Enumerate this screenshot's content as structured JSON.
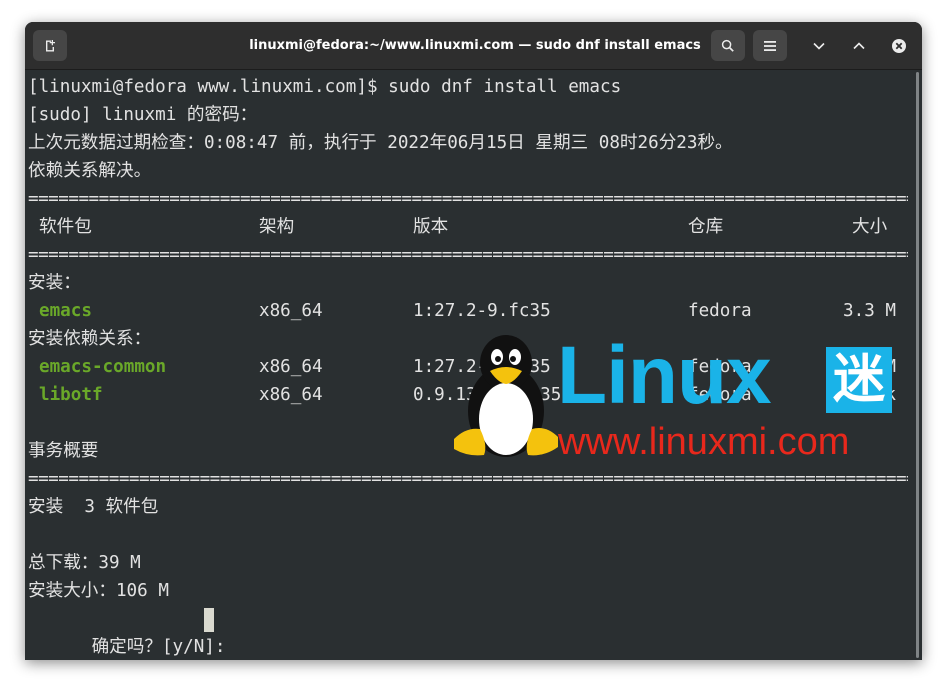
{
  "window": {
    "title": "linuxmi@fedora:~/www.linuxmi.com — sudo dnf install emacs",
    "icons": [
      "new-tab-icon",
      "search-icon",
      "hamburger-menu-icon",
      "minimize-icon",
      "maximize-icon",
      "close-icon"
    ]
  },
  "terminal": {
    "line1": "[linuxmi@fedora www.linuxmi.com]$ sudo dnf install emacs",
    "line2": "[sudo] linuxmi 的密码：",
    "line3": "上次元数据过期检查：0:08:47 前，执行于 2022年06月15日 星期三 08时26分23秒。",
    "line4": "依赖关系解决。",
    "rule": "================================================================================================================================================================",
    "headers": {
      "package": "软件包",
      "arch": "架构",
      "version": "版本",
      "repo": "仓库",
      "size": "大小"
    },
    "install_label": "安装：",
    "deps_label": "安装依赖关系：",
    "packages": [
      {
        "name": "emacs",
        "arch": "x86_64",
        "version": "1:27.2-9.fc35",
        "repo": "fedora",
        "size": "3.3 M"
      },
      {
        "name": "emacs-common",
        "arch": "x86_64",
        "version": "1:27.2-9.fc35",
        "repo": "fedora",
        "size": "35 M"
      },
      {
        "name": "libotf",
        "arch": "x86_64",
        "version": "0.9.13-17.fc35",
        "repo": "fedora",
        "size": "92 k"
      }
    ],
    "summary_label": "事务概要",
    "install_summary": "安装  3 软件包",
    "download_size": "总下载：39 M",
    "install_size": "安装大小：106 M",
    "prompt": "确定吗？[y/N]: "
  },
  "watermark": {
    "word": "Linux",
    "char": "迷",
    "url": "www.linuxmi.com"
  },
  "colors": {
    "terminal_bg": "#2a2f31",
    "titlebar_bg": "#2e2e2e",
    "text": "#e2e2e2",
    "package_green": "#6aa829",
    "logo_blue": "#1ab3e8",
    "logo_red": "#e8281c"
  }
}
